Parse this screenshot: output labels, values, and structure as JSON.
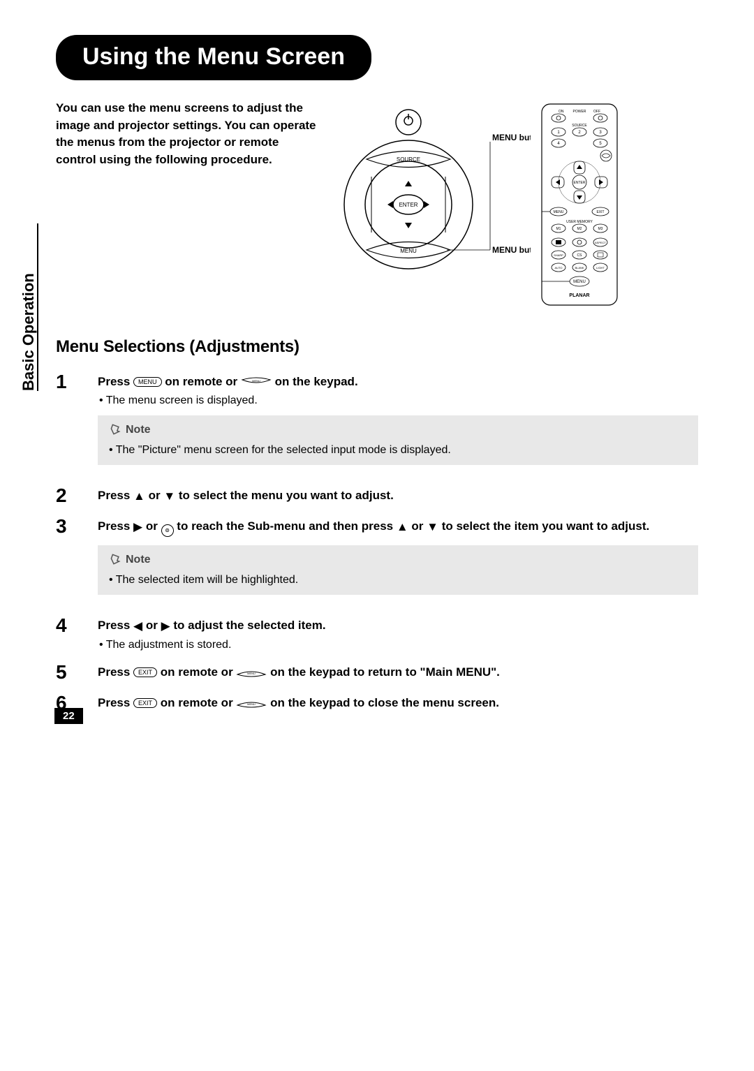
{
  "page_title": "Using the Menu Screen",
  "intro": "You can use the menu screens to adjust the image and projector settings. You can operate the menus from the projector or remote control using the following procedure.",
  "diagram": {
    "menu_button_label": "MENU button",
    "keypad": {
      "source": "SOURCE",
      "enter": "ENTER",
      "menu": "MENU"
    },
    "remote": {
      "power_on": "ON",
      "power": "POWER",
      "power_off": "OFF",
      "source": "SOURCE",
      "src1": "1",
      "src2": "2",
      "src3": "3",
      "src4": "4",
      "src5": "5",
      "enter": "ENTER",
      "menu": "MENU",
      "exit": "EXIT",
      "user_memory": "USER MEMORY",
      "m1": "M1",
      "m2": "M2",
      "m3": "M3",
      "aspect": "ASPECT",
      "sharp": "SHARP",
      "cs": "CS",
      "auto": "AUTO",
      "blank": "BLANK",
      "light": "LIGHT",
      "menu_btn": "MENU",
      "brand": "PLANAR"
    }
  },
  "section_heading": "Menu Selections (Adjustments)",
  "side_tab": "Basic Operation",
  "buttons": {
    "menu": "MENU",
    "exit": "EXIT"
  },
  "steps": {
    "s1": {
      "num": "1",
      "t1": "Press ",
      "t2": " on remote or ",
      "t3": " on the keypad.",
      "bullet": "• The menu screen is displayed.",
      "note_title": "Note",
      "note_body": "• The \"Picture\" menu screen for the selected input mode is displayed."
    },
    "s2": {
      "num": "2",
      "t1": "Press ",
      "t2": " or ",
      "t3": " to select the menu you want to adjust."
    },
    "s3": {
      "num": "3",
      "t1": "Press ",
      "t2": " or ",
      "t3": " to reach the Sub-menu and then press ",
      "t4": " or ",
      "t5": " to select the item you want to adjust.",
      "note_title": "Note",
      "note_body": "• The selected item will be highlighted."
    },
    "s4": {
      "num": "4",
      "t1": "Press ",
      "t2": " or ",
      "t3": " to adjust the selected item.",
      "bullet": "• The adjustment is stored."
    },
    "s5": {
      "num": "5",
      "t1": "Press ",
      "t2": " on remote or ",
      "t3": " on the keypad to return to \"Main MENU\"."
    },
    "s6": {
      "num": "6",
      "t1": "Press ",
      "t2": " on remote or ",
      "t3": " on the keypad to close the menu screen."
    }
  },
  "page_number": "22"
}
